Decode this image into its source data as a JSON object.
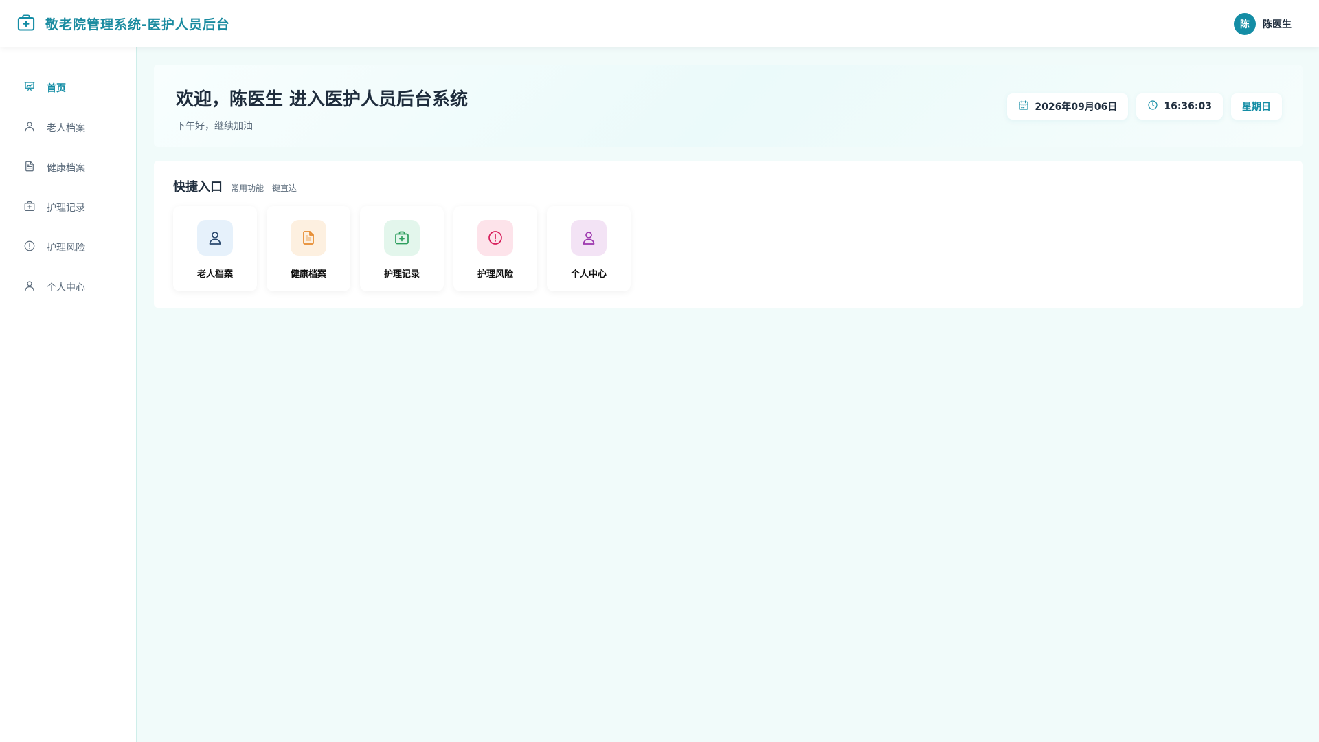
{
  "header": {
    "title": "敬老院管理系统-医护人员后台",
    "logo_icon": "medical-case-icon",
    "user": {
      "avatar_text": "陈",
      "name": "陈医生"
    }
  },
  "sidebar": {
    "items": [
      {
        "label": "首页",
        "icon": "presentation-chart-icon",
        "active": true
      },
      {
        "label": "老人档案",
        "icon": "user-icon",
        "active": false
      },
      {
        "label": "健康档案",
        "icon": "document-icon",
        "active": false
      },
      {
        "label": "护理记录",
        "icon": "medical-case-icon",
        "active": false
      },
      {
        "label": "护理风险",
        "icon": "alert-circle-icon",
        "active": false
      },
      {
        "label": "个人中心",
        "icon": "user-icon",
        "active": false
      }
    ]
  },
  "welcome": {
    "title": "欢迎，陈医生 进入医护人员后台系统",
    "subtitle": "下午好，继续加油",
    "date": "2026年09月06日",
    "time": "16:36:03",
    "weekday": "星期日"
  },
  "quick": {
    "title": "快捷入口",
    "subtitle": "常用功能一键直达",
    "cards": [
      {
        "label": "老人档案",
        "icon": "user-icon",
        "bg": "#e6f1fb",
        "fg": "#2b4a6f"
      },
      {
        "label": "健康档案",
        "icon": "document-icon",
        "bg": "#fdf0e0",
        "fg": "#e68a2e"
      },
      {
        "label": "护理记录",
        "icon": "medical-case-icon",
        "bg": "#e3f6ec",
        "fg": "#2e9e5e"
      },
      {
        "label": "护理风险",
        "icon": "alert-circle-icon",
        "bg": "#fde3ea",
        "fg": "#d81e5b"
      },
      {
        "label": "个人中心",
        "icon": "user-icon",
        "bg": "#f3e3f5",
        "fg": "#9c35ad"
      }
    ]
  },
  "colors": {
    "accent": "#148da5",
    "background": "#f1fbfa"
  }
}
